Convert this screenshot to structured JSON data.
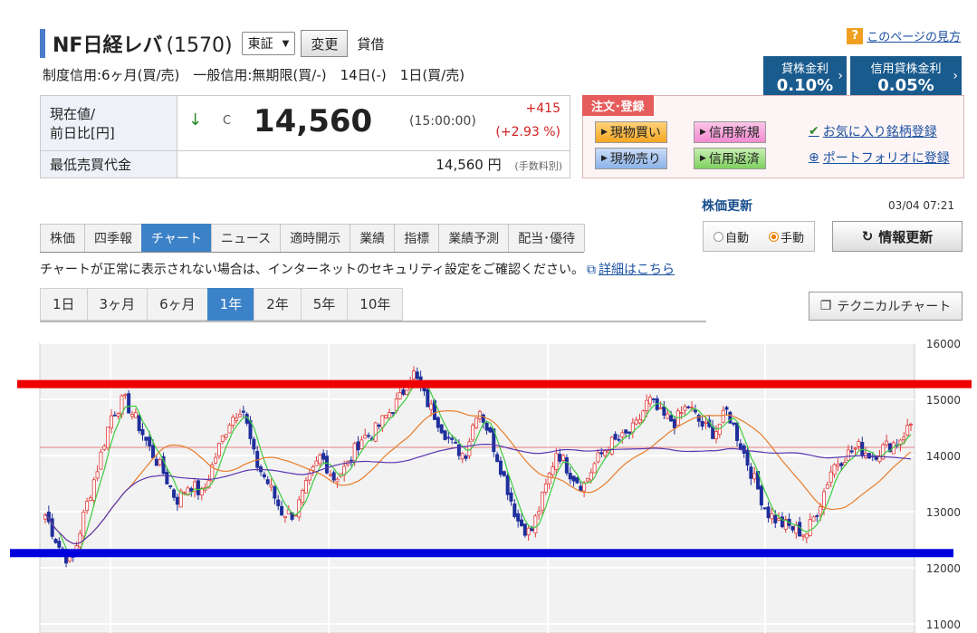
{
  "header": {
    "title": "NF日経レバ",
    "code": "(1570)",
    "market": "東証",
    "change_button": "変更",
    "lending": "貸借",
    "credit_info": "制度信用:6ヶ月(買/売)　一般信用:無期限(買/-)　14日(-)　1日(買/売)",
    "help_icon": "?",
    "help_link": "このページの見方"
  },
  "rates": [
    {
      "label": "貸株金利",
      "value": "0.10%"
    },
    {
      "label": "信用貸株金利",
      "value": "0.05%"
    }
  ],
  "price": {
    "label_current": "現在値/",
    "label_prev": "前日比[円]",
    "arrow": "↓",
    "mark": "C",
    "value": "14,560",
    "time": "(15:00:00)",
    "change": "+415",
    "change_pct": "(+2.93 %)",
    "min_label": "最低売買代金",
    "min_value": "14,560 円",
    "fee_note": "(手数料別)"
  },
  "order": {
    "tab": "注文･登録",
    "buttons": [
      "現物買い",
      "信用新規",
      "現物売り",
      "信用返済"
    ],
    "favorite": "お気に入り銘柄登録",
    "portfolio": "ポートフォリオに登録"
  },
  "update": {
    "title": "株価更新",
    "time": "03/04 07:21",
    "auto": "自動",
    "manual": "手動",
    "refresh": "情報更新"
  },
  "tabs": [
    "株価",
    "四季報",
    "チャート",
    "ニュース",
    "適時開示",
    "業績",
    "指標",
    "業績予測",
    "配当･優待"
  ],
  "active_tab": 2,
  "notice": {
    "text": "チャートが正常に表示されない場合は、インターネットのセキュリティ設定をご確認ください。",
    "link": "詳細はこちら"
  },
  "period_tabs": [
    "1日",
    "3ヶ月",
    "6ヶ月",
    "1年",
    "2年",
    "5年",
    "10年"
  ],
  "active_period": 3,
  "technical_button": "テクニカルチャート",
  "colors": {
    "accent": "#3c82c8",
    "up_candle": "#e23b3b",
    "down_candle": "#1f2f9c",
    "ma_short": "#3ecb3e",
    "ma_mid": "#e87c2a",
    "ma_long": "#5a35b0",
    "ref_line": "#e88080",
    "overlay_red": "#ee0000",
    "overlay_blue": "#0000dd"
  },
  "chart_data": {
    "type": "candlestick",
    "y_ticks": [
      "16000",
      "15000",
      "14000",
      "13000",
      "12000",
      "11000"
    ],
    "ylim": [
      11000,
      16000
    ],
    "reference_price": 14145,
    "overlay_levels": [
      15280,
      12270
    ],
    "close_series": [
      12950,
      12400,
      12050,
      13000,
      13800,
      14700,
      15000,
      14600,
      14100,
      13700,
      13200,
      13500,
      13300,
      14000,
      14600,
      14900,
      13900,
      13500,
      13000,
      12950,
      13500,
      14000,
      13600,
      13800,
      14300,
      14400,
      14700,
      15000,
      15500,
      15000,
      14600,
      14200,
      14000,
      14900,
      14300,
      13600,
      12850,
      12600,
      13300,
      14100,
      13700,
      13450,
      13900,
      14200,
      14300,
      14500,
      15000,
      14700,
      14600,
      14900,
      14550,
      14400,
      14800,
      14200,
      13600,
      13000,
      12800,
      12700,
      12600,
      13100,
      13800,
      14000,
      14150,
      14000,
      14150,
      14250,
      14560
    ]
  }
}
